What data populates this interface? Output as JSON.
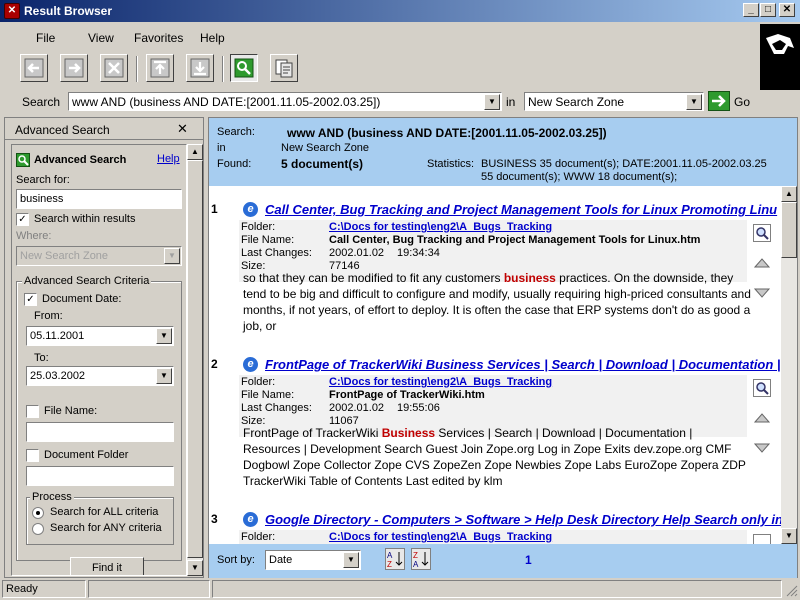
{
  "window": {
    "title": "Result Browser"
  },
  "menu": [
    "File",
    "View",
    "Favorites",
    "Help"
  ],
  "searchbar": {
    "label": "Search",
    "query": "www AND (business AND DATE:[2001.11.05-2002.03.25])",
    "in_label": "in",
    "zone": "New Search Zone",
    "go_label": "Go"
  },
  "left_panel": {
    "header": "Advanced Search",
    "title": "Advanced Search",
    "help_link": "Help",
    "search_for_label": "Search for:",
    "search_for_value": "business",
    "search_within_label": "Search within results",
    "where_label": "Where:",
    "where_value": "New Search Zone",
    "criteria_label": "Advanced Search Criteria",
    "doc_date_label": "Document Date:",
    "from_label": "From:",
    "from_value": "05.11.2001",
    "to_label": "To:",
    "to_value": "25.03.2002",
    "file_name_label": "File Name:",
    "doc_folder_label": "Document Folder",
    "process_label": "Process",
    "all_label": "Search for ALL criteria",
    "any_label": "Search for ANY criteria",
    "find_button": "Find it"
  },
  "summary": {
    "search_label": "Search:",
    "search_value": "www AND (business AND DATE:[2001.11.05-2002.03.25])",
    "in_label": "in",
    "in_value": "New Search Zone",
    "found_label": "Found:",
    "found_value": "5 document(s)",
    "stats_label": "Statistics:",
    "stats_value": "BUSINESS 35 document(s); DATE:2001.11.05-2002.03.25 55 document(s); WWW 18 document(s);"
  },
  "meta_labels": {
    "folder": "Folder:",
    "file": "File Name:",
    "changes": "Last Changes:",
    "size": "Size:"
  },
  "results": [
    {
      "num": "1",
      "title": "Call Center, Bug Tracking and Project Management Tools for Linux Promoting Linu",
      "folder": "C:\\Docs for testing\\eng2\\A_Bugs_Tracking",
      "file": "Call Center, Bug Tracking and Project Management Tools for Linux.htm",
      "date": "2002.01.02",
      "time": "19:34:34",
      "size": "77146",
      "snip_pre": "so that they can be modified to fit any customers ",
      "snip_hit": "business",
      "snip_post": " practices. On the downside, they tend to be big and difficult to configure and modify, usually requiring high-priced consultants and months, if not years, of effort to deploy. It is often the case that ERP systems don't do as good a job, or"
    },
    {
      "num": "2",
      "title": "FrontPage of TrackerWiki Business Services | Search | Download | Documentation |",
      "folder": "C:\\Docs for testing\\eng2\\A_Bugs_Tracking",
      "file": "FrontPage of TrackerWiki.htm",
      "date": "2002.01.02",
      "time": "19:55:06",
      "size": "11067",
      "snip_pre": "FrontPage of TrackerWiki ",
      "snip_hit": "Business",
      "snip_post": " Services | Search | Download | Documentation | Resources | Development Search Guest Join Zope.org Log in Zope Exits dev.zope.org CMF Dogbowl Zope Collector Zope CVS ZopeZen Zope Newbies Zope Labs EuroZope Zopera ZDP TrackerWiki Table of Contents Last edited by klm"
    },
    {
      "num": "3",
      "title": "Google Directory - Computers > Software > Help Desk Directory Help Search only in",
      "folder": "C:\\Docs for testing\\eng2\\A_Bugs_Tracking"
    }
  ],
  "footer": {
    "sort_label": "Sort by:",
    "sort_value": "Date",
    "page": "1"
  },
  "status": {
    "text": "Ready"
  }
}
